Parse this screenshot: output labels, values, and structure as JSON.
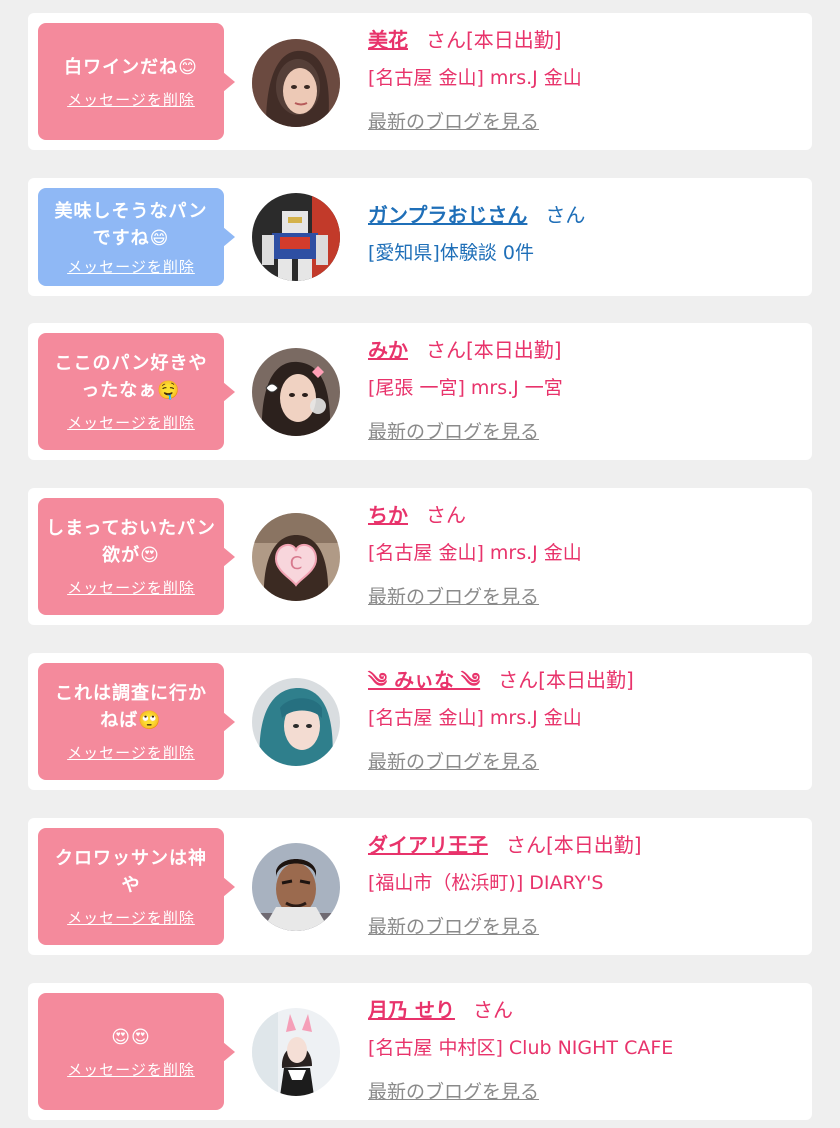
{
  "colors": {
    "pink": "#f48a9c",
    "blue": "#8fb8f5",
    "name_pink": "#e8336b",
    "name_blue": "#1f6fb8",
    "muted_gray": "#8a8a8a"
  },
  "messages": [
    {
      "bubble_text": "白ワインだね😊",
      "delete_label": "メッセージを削除",
      "name": "美花",
      "suffix": "さん[本日出勤]",
      "detail": "[名古屋 金山] mrs.J 金山",
      "blog_label": "最新のブログを見る",
      "avatar_icon": "woman-portrait-icon"
    },
    {
      "bubble_text": "美味しそうなパンですね😄",
      "delete_label": "メッセージを削除",
      "name": "ガンプラおじさん",
      "suffix": "さん",
      "detail": "[愛知県]体験談 0件",
      "blog_label": "",
      "avatar_icon": "robot-model-icon"
    },
    {
      "bubble_text": "ここのパン好きやったなぁ🤤",
      "delete_label": "メッセージを削除",
      "name": "みか",
      "suffix": "さん[本日出勤]",
      "detail": "[尾張 一宮] mrs.J 一宮",
      "blog_label": "最新のブログを見る",
      "avatar_icon": "woman-with-stickers-icon"
    },
    {
      "bubble_text": "しまっておいたパン欲が😍",
      "delete_label": "メッセージを削除",
      "name": "ちか",
      "suffix": "さん",
      "detail": "[名古屋 金山] mrs.J 金山",
      "blog_label": "最新のブログを見る",
      "avatar_icon": "heart-sticker-portrait-icon"
    },
    {
      "bubble_text": "これは調査に行かねば🙄",
      "delete_label": "メッセージを削除",
      "name": "༄ みぃな ༄",
      "suffix": "さん[本日出勤]",
      "detail": "[名古屋 金山] mrs.J 金山",
      "blog_label": "最新のブログを見る",
      "avatar_icon": "blue-hair-portrait-icon"
    },
    {
      "bubble_text": "クロワッサンは神や",
      "delete_label": "メッセージを削除",
      "name": "ダイアリ王子",
      "suffix": "さん[本日出勤]",
      "detail": "[福山市（松浜町)] DIARY'S",
      "blog_label": "最新のブログを見る",
      "avatar_icon": "man-portrait-icon"
    },
    {
      "bubble_text": "😍😍",
      "delete_label": "メッセージを削除",
      "name": "月乃 せり",
      "suffix": "さん",
      "detail": "[名古屋 中村区] Club NIGHT CAFE",
      "blog_label": "最新のブログを見る",
      "avatar_icon": "bunny-ears-portrait-icon"
    }
  ]
}
